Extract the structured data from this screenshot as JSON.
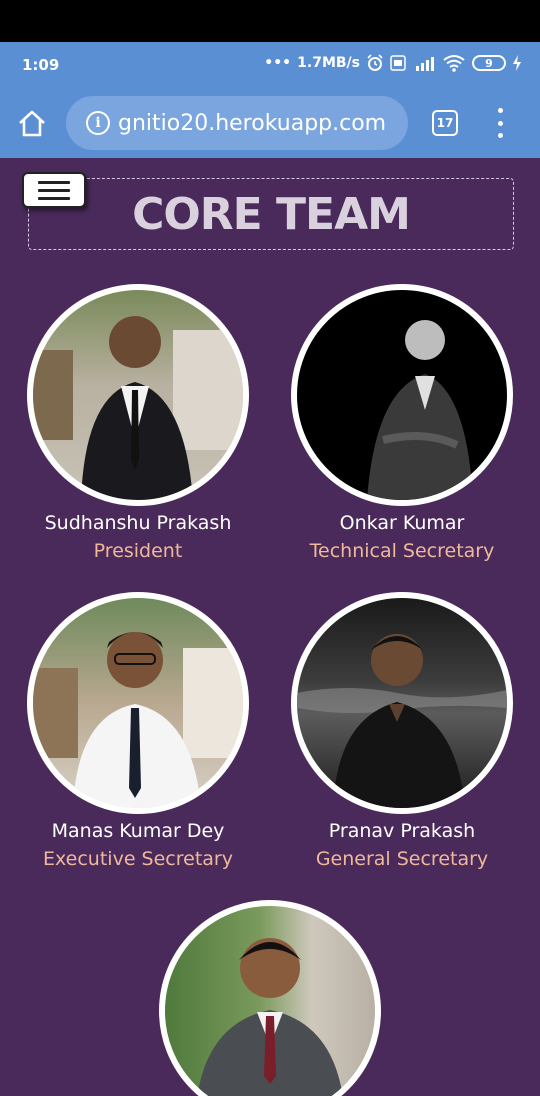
{
  "status": {
    "time": "1:09",
    "net_speed": "1.7MB/s",
    "battery": "9"
  },
  "browser": {
    "url": "gnitio20.herokuapp.com",
    "tabs_count": "17"
  },
  "page": {
    "title": "CORE TEAM",
    "members": [
      {
        "name": "Sudhanshu Prakash",
        "role": "President"
      },
      {
        "name": "Onkar Kumar",
        "role": "Technical Secretary"
      },
      {
        "name": "Manas Kumar Dey",
        "role": "Executive Secretary"
      },
      {
        "name": "Pranav Prakash",
        "role": "General Secretary"
      },
      {
        "name": "",
        "role": ""
      }
    ]
  },
  "colors": {
    "page_bg": "#4a2a5a",
    "browser_bar": "#5b8fd4",
    "role_text": "#f0b89a"
  }
}
